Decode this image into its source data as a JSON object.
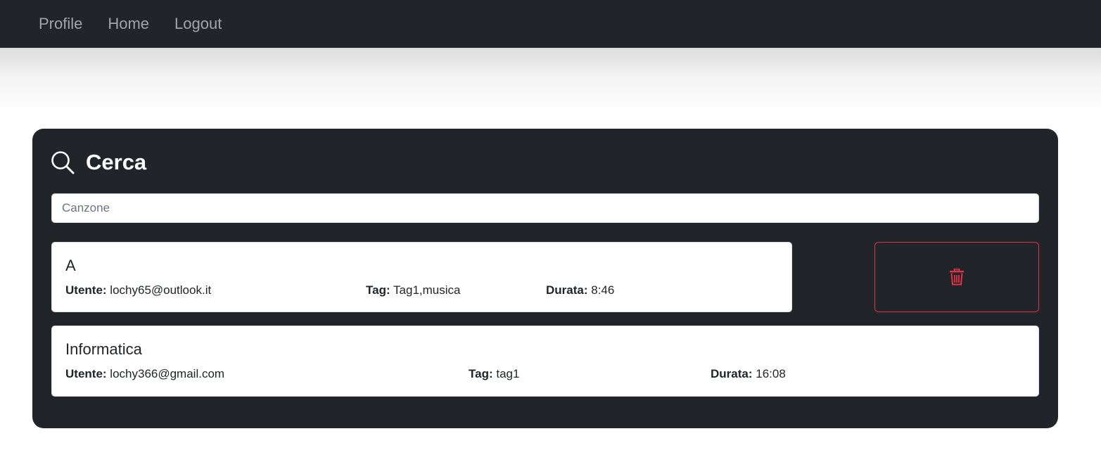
{
  "navbar": {
    "links": [
      {
        "label": "Profile"
      },
      {
        "label": "Home"
      },
      {
        "label": "Logout"
      }
    ]
  },
  "search": {
    "icon": "search-icon",
    "title": "Cerca",
    "placeholder": "Canzone",
    "value": ""
  },
  "results": [
    {
      "title": "A",
      "user_label": "Utente:",
      "user": "lochy65@outlook.it",
      "tag_label": "Tag:",
      "tag": "Tag1,musica",
      "duration_label": "Durata:",
      "duration": "8:46"
    },
    {
      "title": "Informatica",
      "user_label": "Utente:",
      "user": "lochy366@gmail.com",
      "tag_label": "Tag:",
      "tag": "tag1",
      "duration_label": "Durata:",
      "duration": "16:08"
    }
  ],
  "delete_button": {
    "icon": "trash-icon",
    "color": "#dc3545"
  },
  "colors": {
    "dark": "#212529",
    "danger": "#dc3545",
    "nav_link": "#8e9092"
  }
}
